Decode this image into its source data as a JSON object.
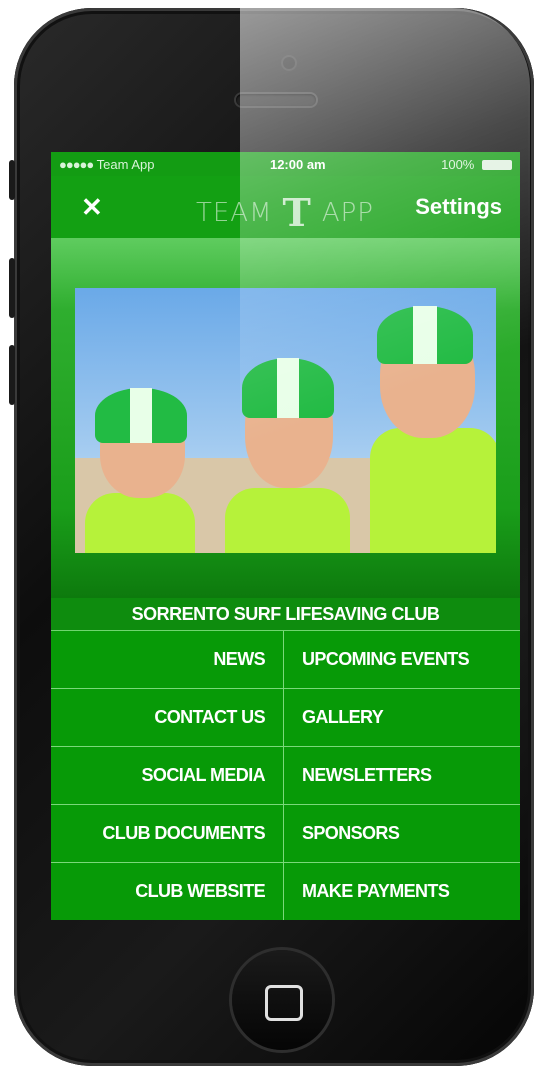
{
  "status_bar": {
    "signal": "●●●●●",
    "carrier": "Team App",
    "time": "12:00 am",
    "battery": "100%"
  },
  "navbar": {
    "close_glyph": "✕",
    "logo_left": "TEAM",
    "logo_mark": "T",
    "logo_right": "APP",
    "settings_label": "Settings"
  },
  "club": {
    "title": "SORRENTO SURF LIFESAVING CLUB"
  },
  "menu": [
    {
      "left": "NEWS",
      "right": "UPCOMING EVENTS"
    },
    {
      "left": "CONTACT US",
      "right": "GALLERY"
    },
    {
      "left": "SOCIAL MEDIA",
      "right": "NEWSLETTERS"
    },
    {
      "left": "CLUB DOCUMENTS",
      "right": "SPONSORS"
    },
    {
      "left": "CLUB WEBSITE",
      "right": "MAKE PAYMENTS"
    }
  ],
  "colors": {
    "accent_green": "#13a013",
    "menu_green": "#079a07"
  }
}
